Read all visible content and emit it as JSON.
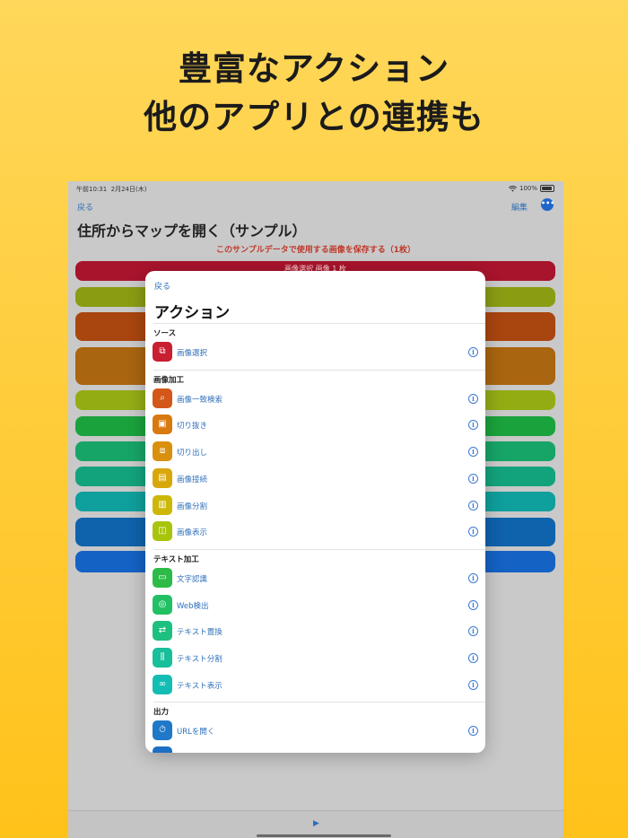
{
  "headline": {
    "line1": "豊富なアクション",
    "line2": "他のアプリとの連携も"
  },
  "status": {
    "time": "午前10:31",
    "date": "2月24日(木)",
    "wifi": "wifi-icon",
    "battery": "100%"
  },
  "nav": {
    "back": "戻る",
    "edit": "編集",
    "more": "•••"
  },
  "document": {
    "title": "住所からマップを開く（サンプル）",
    "save_notice": "このサンプルデータで使用する画像を保存する（1枚）",
    "first_bar_label": "画像選択 画像 1 枚"
  },
  "modal": {
    "back": "戻る",
    "title": "アクション",
    "sections": [
      {
        "title": "ソース",
        "items": [
          {
            "label": "画像選択",
            "icon": "image-select-icon",
            "glyph": "⧉",
            "color": "#c81f31"
          }
        ]
      },
      {
        "title": "画像加工",
        "items": [
          {
            "label": "画像一致検索",
            "icon": "magnifier-icon",
            "glyph": "⌕",
            "color": "#d4571a"
          },
          {
            "label": "切り抜き",
            "icon": "crop-icon",
            "glyph": "▣",
            "color": "#d97a10"
          },
          {
            "label": "切り出し",
            "icon": "cut-out-icon",
            "glyph": "⧈",
            "color": "#d9900f"
          },
          {
            "label": "画像接続",
            "icon": "image-join-icon",
            "glyph": "▤",
            "color": "#d8a70c"
          },
          {
            "label": "画像分割",
            "icon": "image-split-icon",
            "glyph": "▥",
            "color": "#cdb80a"
          },
          {
            "label": "画像表示",
            "icon": "image-view-icon",
            "glyph": "◫",
            "color": "#a9c40c"
          }
        ]
      },
      {
        "title": "テキスト加工",
        "items": [
          {
            "label": "文字認識",
            "icon": "text-recognition-icon",
            "glyph": "▭",
            "color": "#2dbb48"
          },
          {
            "label": "Web検出",
            "icon": "web-detect-icon",
            "glyph": "◎",
            "color": "#22c064"
          },
          {
            "label": "テキスト置換",
            "icon": "text-replace-icon",
            "glyph": "⇄",
            "color": "#1ec07f"
          },
          {
            "label": "テキスト分割",
            "icon": "text-split-icon",
            "glyph": "⫼",
            "color": "#18bf9a"
          },
          {
            "label": "テキスト表示",
            "icon": "text-view-icon",
            "glyph": "∞",
            "color": "#14bdb4"
          }
        ]
      },
      {
        "title": "出力",
        "items": [
          {
            "label": "URLを開く",
            "icon": "open-url-icon",
            "glyph": "⏱",
            "color": "#1f78c8"
          }
        ]
      }
    ]
  },
  "background_bars": [
    {
      "color": "#a8142c"
    },
    {
      "color": "#8a9c12"
    },
    {
      "color": "#a9450f"
    },
    {
      "color": "#a9650f"
    },
    {
      "color": "#94ac14"
    },
    {
      "color": "#1aa23c"
    },
    {
      "color": "#17a467"
    },
    {
      "color": "#13a37c"
    },
    {
      "color": "#0f9f9c"
    },
    {
      "color": "#0f62ac"
    },
    {
      "color": "#1462c4"
    }
  ],
  "bottom": {
    "play": "▶"
  }
}
